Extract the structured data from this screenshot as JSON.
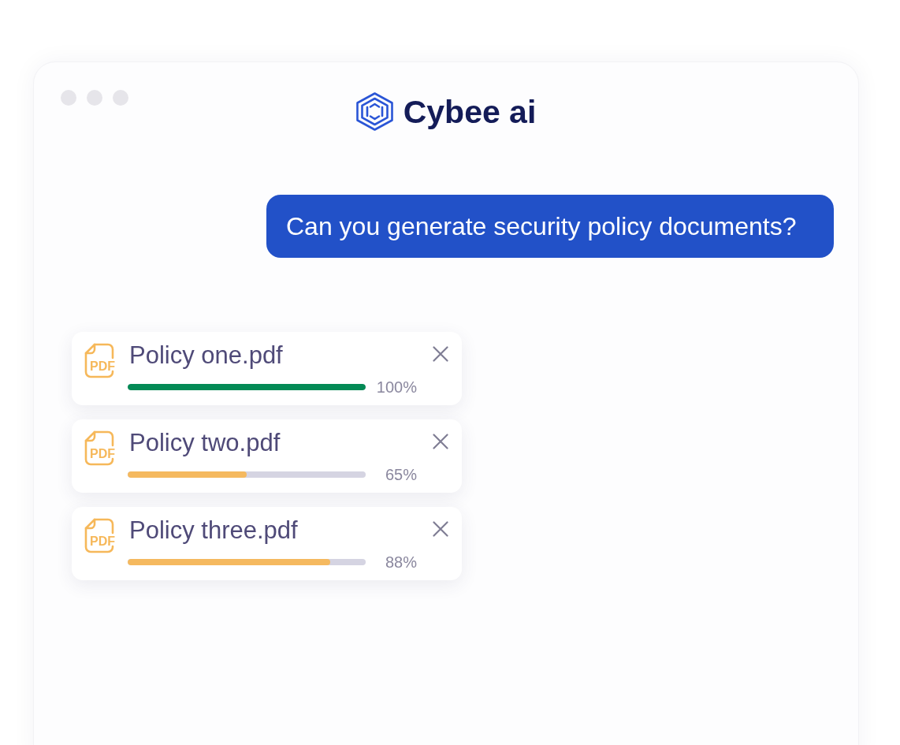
{
  "app": {
    "name": "Cybee ai"
  },
  "chat": {
    "message": {
      "text": "Can you generate security policy documents?"
    }
  },
  "files": [
    {
      "name": "Policy one.pdf",
      "type_label": "PDF",
      "level": 1,
      "reading": "100%",
      "color": "#038a55"
    },
    {
      "name": "Policy two.pdf",
      "type_label": "PDF",
      "level": 0.5,
      "reading": "65%",
      "color": "#f5b95f"
    },
    {
      "name": "Policy three.pdf",
      "type_label": "PDF",
      "level": 0.85,
      "reading": "88%",
      "color": "#f5b95f"
    }
  ]
}
